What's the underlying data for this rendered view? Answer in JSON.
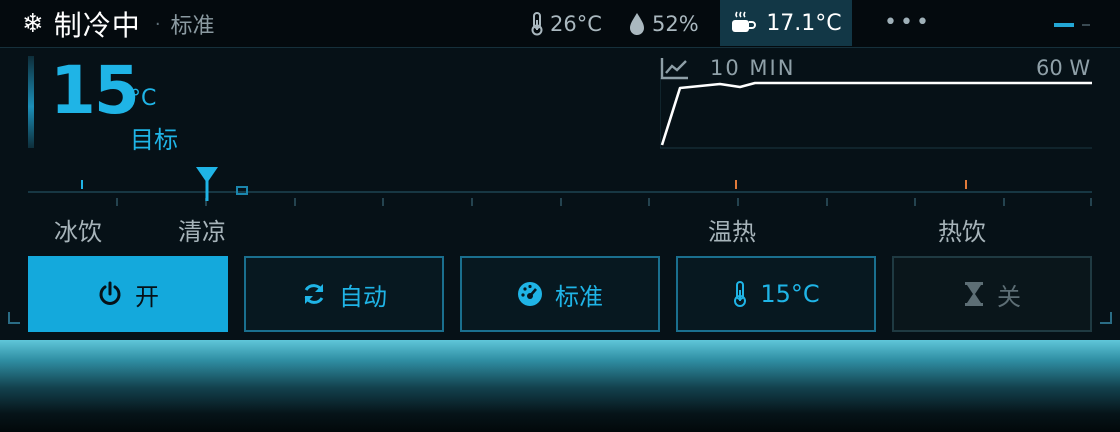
{
  "status": {
    "mode_label": "制冷中",
    "separator": "·",
    "mode_sub": "标准",
    "ambient_temp": "26°C",
    "humidity": "52%",
    "cup_temp": "17.1°C"
  },
  "target": {
    "value": "15",
    "unit": "°C",
    "label": "目标"
  },
  "chart": {
    "window": "10 MIN",
    "power": "60 W"
  },
  "scale": {
    "position_fraction": 0.17
  },
  "presets": [
    {
      "label": "冰饮"
    },
    {
      "label": "清凉"
    },
    {
      "label": "温热"
    },
    {
      "label": "热饮"
    }
  ],
  "buttons": {
    "power": "开",
    "auto": "自动",
    "standard": "标准",
    "temp": "15°C",
    "timer": "关"
  },
  "colors": {
    "accent": "#1fb4e6",
    "warm_mark": "#e07a3a",
    "background": "#061117"
  },
  "icons": [
    "snowflake-icon",
    "thermometer-icon",
    "droplet-icon",
    "cup-icon",
    "chart-icon",
    "power-icon",
    "refresh-icon",
    "gauge-icon",
    "hourglass-icon"
  ]
}
